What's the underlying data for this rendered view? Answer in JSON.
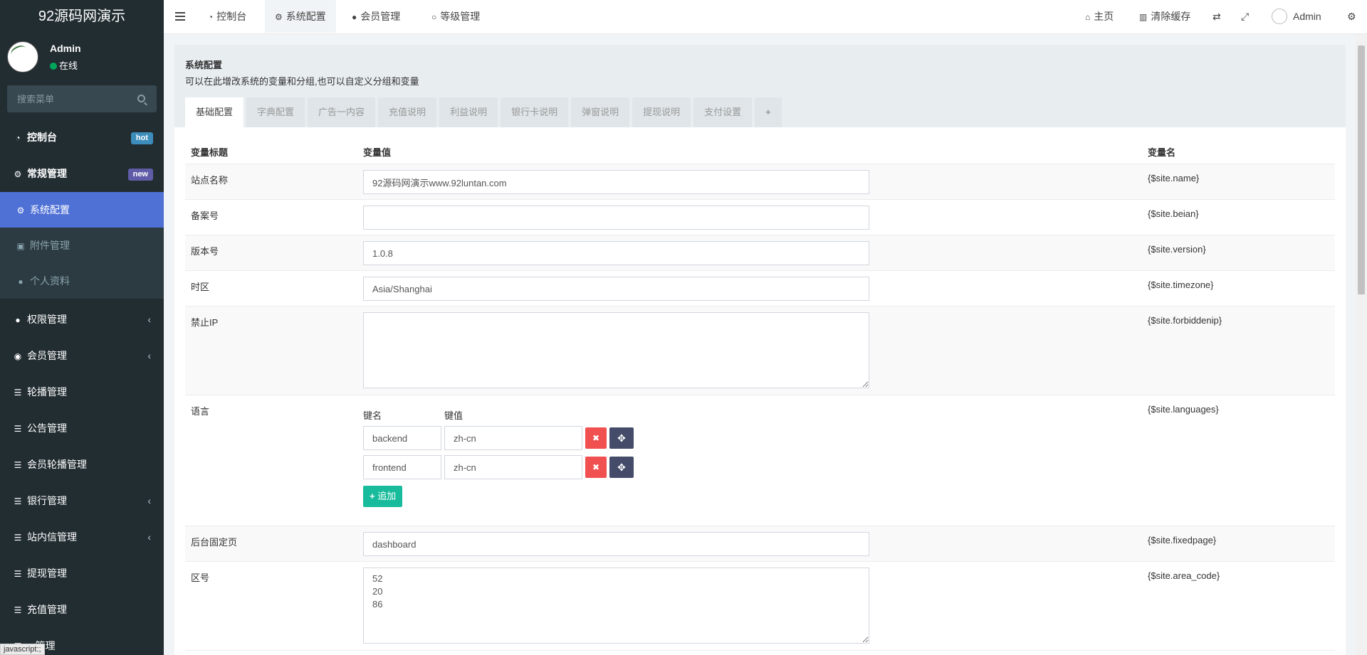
{
  "sidebar": {
    "logo": "92源码网演示",
    "user": {
      "name": "Admin",
      "status": "在线"
    },
    "search_placeholder": "搜索菜单",
    "items": [
      {
        "label": "控制台",
        "badge": "hot"
      },
      {
        "label": "常规管理",
        "badge": "new"
      },
      {
        "label": "权限管理"
      },
      {
        "label": "会员管理"
      },
      {
        "label": "轮播管理"
      },
      {
        "label": "公告管理"
      },
      {
        "label": "会员轮播管理"
      },
      {
        "label": "银行管理"
      },
      {
        "label": "站内信管理"
      },
      {
        "label": "提现管理"
      },
      {
        "label": "充值管理"
      },
      {
        "label": "...管理"
      }
    ],
    "submenu": [
      {
        "label": "系统配置"
      },
      {
        "label": "附件管理"
      },
      {
        "label": "个人资料"
      }
    ]
  },
  "topbar": {
    "nav": [
      {
        "label": "控制台"
      },
      {
        "label": "系统配置"
      },
      {
        "label": "会员管理"
      },
      {
        "label": "等级管理"
      }
    ],
    "home": "主页",
    "clear_cache": "清除缓存",
    "user": "Admin"
  },
  "panel": {
    "title": "系统配置",
    "desc": "可以在此增改系统的变量和分组,也可以自定义分组和变量",
    "tabs": [
      "基础配置",
      "字典配置",
      "广告一内容",
      "充值说明",
      "利益说明",
      "银行卡说明",
      "弹窗说明",
      "提现说明",
      "支付设置",
      "+"
    ]
  },
  "table": {
    "headers": {
      "title": "变量标题",
      "value": "变量值",
      "name": "变量名"
    },
    "rows": [
      {
        "label": "站点名称",
        "value": "92源码网演示www.92luntan.com",
        "var": "{$site.name}"
      },
      {
        "label": "备案号",
        "value": "",
        "var": "{$site.beian}"
      },
      {
        "label": "版本号",
        "value": "1.0.8",
        "var": "{$site.version}"
      },
      {
        "label": "时区",
        "value": "Asia/Shanghai",
        "var": "{$site.timezone}"
      },
      {
        "label": "禁止IP",
        "value": "",
        "var": "{$site.forbiddenip}"
      },
      {
        "label": "语言",
        "var": "{$site.languages}"
      },
      {
        "label": "后台固定页",
        "value": "dashboard",
        "var": "{$site.fixedpage}"
      },
      {
        "label": "区号",
        "value": "52\n20\n86",
        "var": "{$site.area_code}"
      }
    ],
    "languages": {
      "key_header": "键名",
      "value_header": "键值",
      "pairs": [
        {
          "key": "backend",
          "value": "zh-cn"
        },
        {
          "key": "frontend",
          "value": "zh-cn"
        }
      ],
      "add_label": "追加"
    }
  },
  "statusbar": "javascript:;"
}
